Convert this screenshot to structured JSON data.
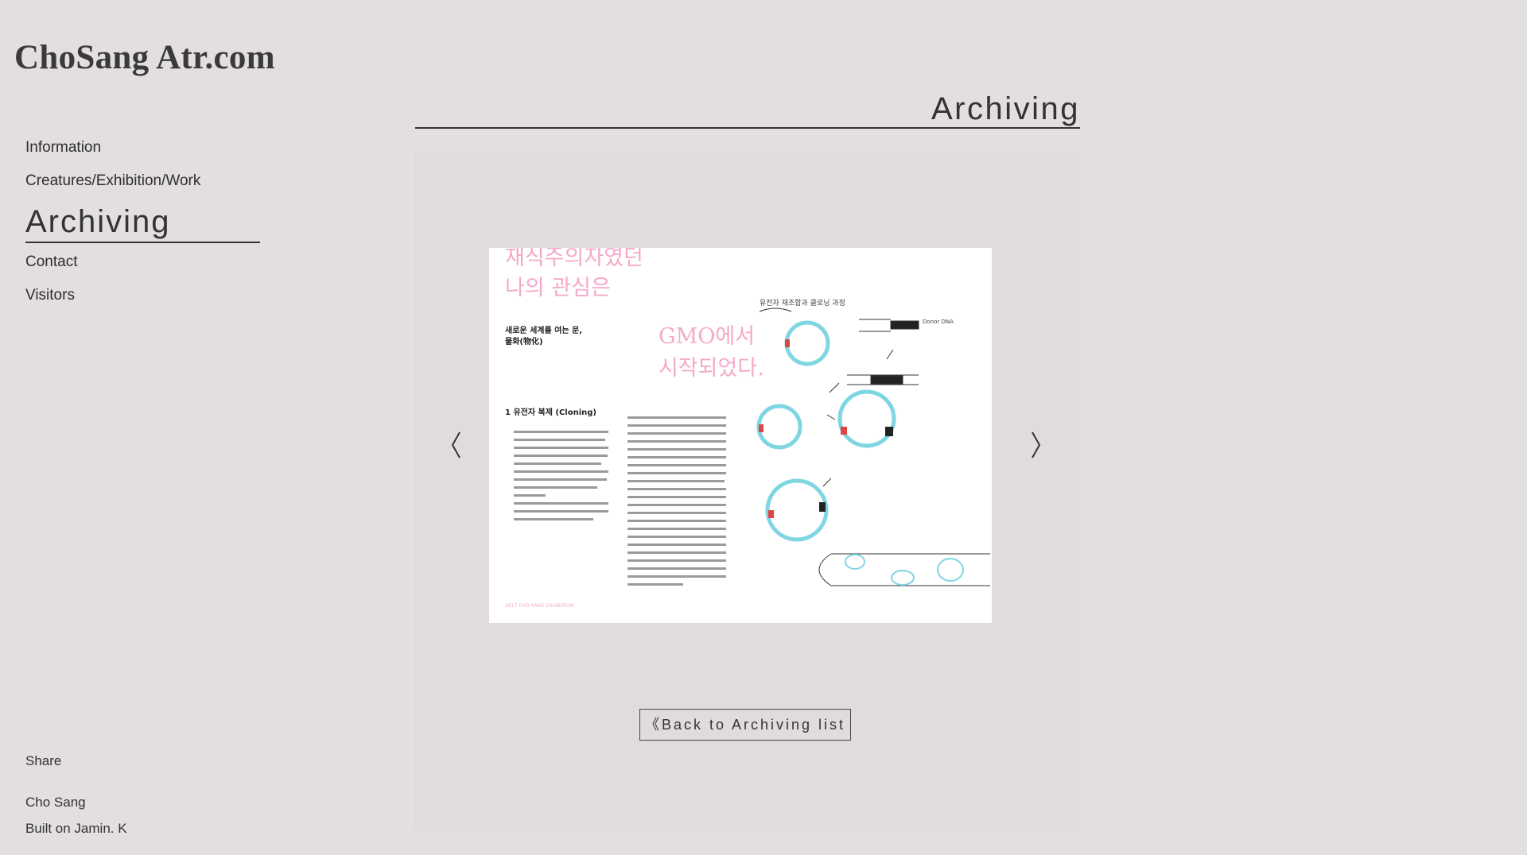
{
  "site": {
    "title": "ChoSang Atr.com"
  },
  "nav": {
    "items": [
      {
        "label": "Information",
        "active": false
      },
      {
        "label": "Creatures/Exhibition/Work",
        "active": false
      },
      {
        "label": "Archiving",
        "active": true
      },
      {
        "label": "Contact",
        "active": false
      },
      {
        "label": "Visitors",
        "active": false
      }
    ]
  },
  "main": {
    "heading": "Archiving",
    "back_label": "Back to Archiving list",
    "back_icon": "double-chevron-left-icon",
    "prev_icon": "chevron-left-icon",
    "next_icon": "chevron-right-icon"
  },
  "slide": {
    "headline_top": "재식주의자였던\n나의 관심은",
    "sub_heading": "새로운 세계를 여는 문,\n물화(物化)",
    "gmo_heading": "GMO에서\n시작되었다.",
    "section_title": "1 유전자 복제 (Cloning)",
    "handwriting_top": "유전자 재조합과 클로닝\n과정",
    "handwriting_dna": "Donor DNA",
    "footer_note": "2017 CHO SANG EXHIBITION",
    "accent_pink": "#f5a9c9",
    "accent_cyan": "#7fd6e2"
  },
  "sidebar_footer": {
    "share": "Share",
    "author": "Cho Sang",
    "built_on": "Built on Jamin. K"
  }
}
